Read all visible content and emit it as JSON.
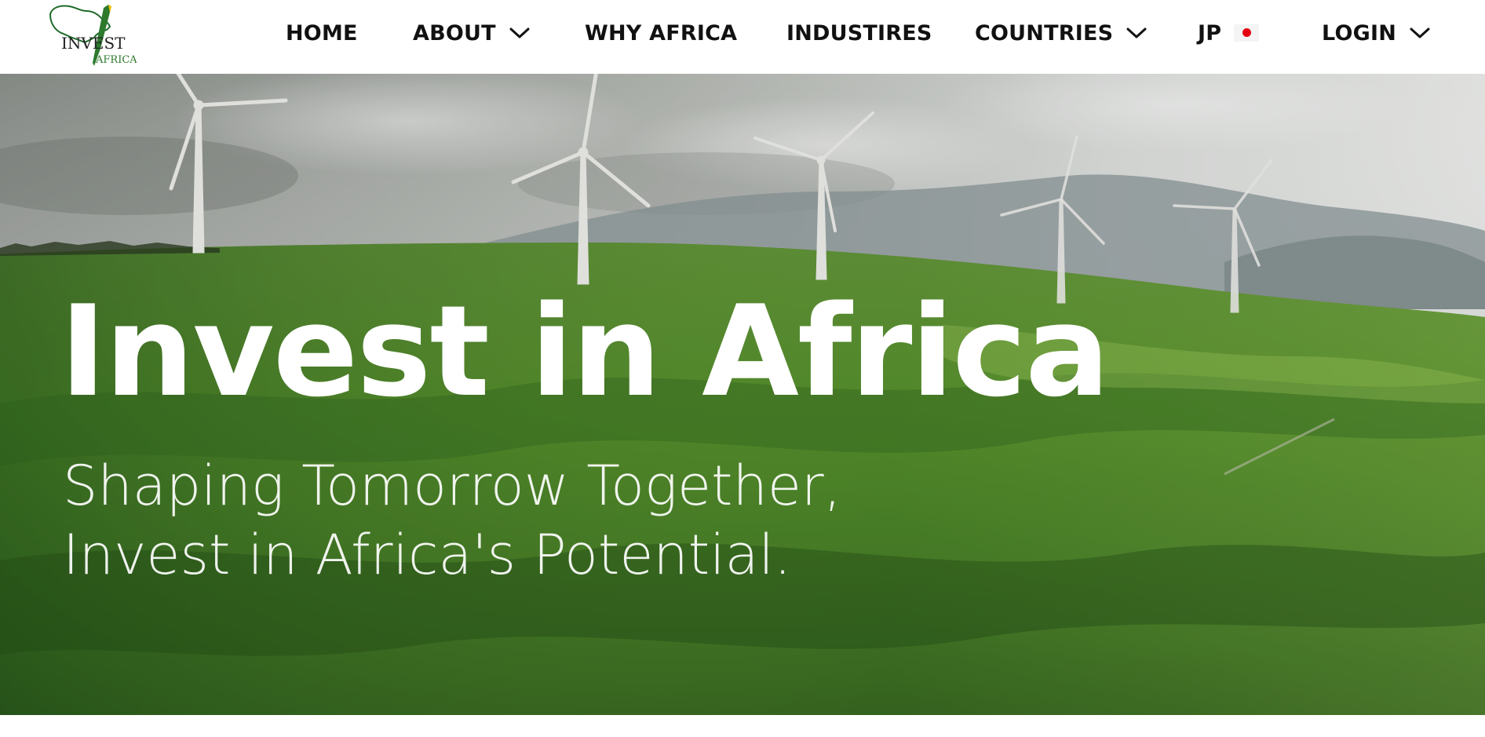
{
  "logo": {
    "alt": "Invest Africa logo",
    "text_line1": "INVEST",
    "text_line2": "AFRICA",
    "colors": {
      "outline": "#1f6b2a",
      "accent": "#f2c200",
      "text": "#222222"
    }
  },
  "nav": {
    "items": [
      {
        "label": "HOME",
        "has_dropdown": false
      },
      {
        "label": "ABOUT",
        "has_dropdown": true,
        "icon": "chevron-down-icon"
      },
      {
        "label": "WHY AFRICA",
        "has_dropdown": false
      },
      {
        "label": "INDUSTIRES",
        "has_dropdown": false
      },
      {
        "label": "COUNTRIES",
        "has_dropdown": true,
        "icon": "chevron-down-icon"
      },
      {
        "label": "JP",
        "has_dropdown": false,
        "icon": "japan-flag-icon"
      },
      {
        "label": "LOGIN",
        "has_dropdown": true,
        "icon": "chevron-down-icon"
      }
    ]
  },
  "hero": {
    "title": "Invest in Africa",
    "subtitle_line1": "Shaping Tomorrow Together,",
    "subtitle_line2": "Invest in Africa's Potential.",
    "background": "green rolling hills with wind turbines",
    "colors": {
      "sky": "#c9ccc8",
      "hills": "#4e8a2c",
      "text": "#ffffff"
    }
  }
}
